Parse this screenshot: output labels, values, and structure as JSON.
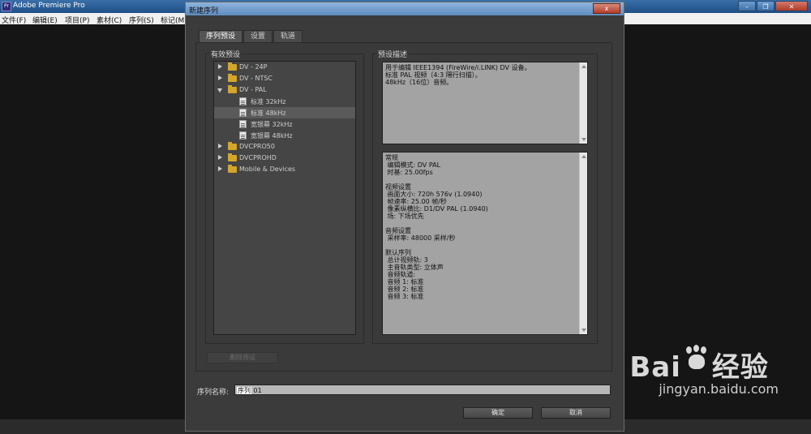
{
  "app": {
    "title": "Adobe Premiere Pro",
    "logo": "Pr",
    "menu": [
      "文件(F)",
      "编辑(E)",
      "项目(P)",
      "素材(C)",
      "序列(S)",
      "标记(M"
    ]
  },
  "dialog": {
    "title": "新建序列",
    "close_label": "x",
    "tabs": [
      "序列预设",
      "设置",
      "轨道"
    ],
    "presets_label": "有效预设",
    "desc_label": "预设描述",
    "tree": [
      {
        "label": "DV - 24P",
        "type": "folder",
        "expanded": false,
        "depth": 0
      },
      {
        "label": "DV - NTSC",
        "type": "folder",
        "expanded": false,
        "depth": 0
      },
      {
        "label": "DV - PAL",
        "type": "folder",
        "expanded": true,
        "depth": 0
      },
      {
        "label": "标准 32kHz",
        "type": "file",
        "depth": 1
      },
      {
        "label": "标准 48kHz",
        "type": "file",
        "depth": 1,
        "selected": true
      },
      {
        "label": "宽银幕 32kHz",
        "type": "file",
        "depth": 1
      },
      {
        "label": "宽银幕 48kHz",
        "type": "file",
        "depth": 1
      },
      {
        "label": "DVCPRO50",
        "type": "folder",
        "expanded": false,
        "depth": 0
      },
      {
        "label": "DVCPROHD",
        "type": "folder",
        "expanded": false,
        "depth": 0
      },
      {
        "label": "Mobile & Devices",
        "type": "folder",
        "expanded": false,
        "depth": 0
      }
    ],
    "description_top": "用于编辑 IEEE1394 (FireWire/i.LINK) DV 设备。\n标准 PAL 视频（4:3 隔行扫描）。\n48kHz（16位）音频。",
    "description_bottom": "常规\n 编辑模式: DV PAL\n 时基: 25.00fps\n\n视频设置\n 画面大小: 720h 576v (1.0940)\n 帧速率: 25.00 帧/秒\n 像素纵横比: D1/DV PAL (1.0940)\n 场: 下场优先\n\n音频设置\n 采样率: 48000 采样/秒\n\n默认序列\n 总计视频轨: 3\n 主音轨类型: 立体声\n 音频轨道:\n 音频 1: 标准\n 音频 2: 标准\n 音频 3: 标准",
    "delete_preset_label": "删除预设",
    "sequence_name_label": "序列名称:",
    "sequence_name_highlight": "序列",
    "sequence_name_rest": " 01",
    "ok_label": "确定",
    "cancel_label": "取消"
  },
  "watermark": {
    "brand_left": "Bai",
    "brand_right": "经验",
    "url": "jingyan.baidu.com"
  },
  "colors": {
    "titlebar": "#3a6fa8",
    "dialog_bg": "#3b3b3b",
    "folder": "#d4a62a",
    "desc_bg": "#a3a3a3"
  }
}
